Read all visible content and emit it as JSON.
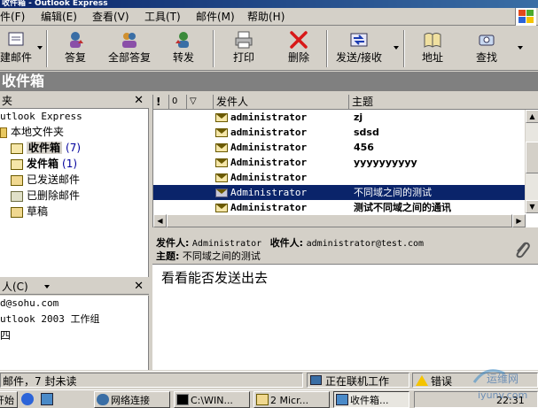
{
  "window": {
    "title": "收件箱 - Outlook Express"
  },
  "menu": [
    "件(F)",
    "编辑(E)",
    "查看(V)",
    "工具(T)",
    "邮件(M)",
    "帮助(H)"
  ],
  "toolbar": {
    "new_mail": "建邮件",
    "reply": "答复",
    "reply_all": "全部答复",
    "forward": "转发",
    "print": "打印",
    "delete": "删除",
    "send_receive": "发送/接收",
    "addresses": "地址",
    "find": "查找"
  },
  "folder_header": "收件箱",
  "folders_pane": {
    "title": "夹",
    "root": "utlook Express",
    "items": [
      {
        "label": "本地文件夹",
        "count": ""
      },
      {
        "label": "收件箱",
        "count": "(7)"
      },
      {
        "label": "发件箱",
        "count": "(1)"
      },
      {
        "label": "已发送邮件",
        "count": ""
      },
      {
        "label": "已删除邮件",
        "count": ""
      },
      {
        "label": "草稿",
        "count": ""
      }
    ]
  },
  "contacts_pane": {
    "title": "人(C)",
    "items": [
      "d@sohu.com",
      "utlook 2003 工作组",
      "四"
    ]
  },
  "message_list": {
    "columns": {
      "priority": "!",
      "attachment": "0",
      "flag": "▽",
      "from": "发件人",
      "subject": "主题"
    },
    "rows": [
      {
        "from": "administrator",
        "subject": "zj",
        "unread": true,
        "selected": false
      },
      {
        "from": "administrator",
        "subject": "sdsd",
        "unread": true,
        "selected": false
      },
      {
        "from": "Administrator",
        "subject": "456",
        "unread": true,
        "selected": false
      },
      {
        "from": "Administrator",
        "subject": "yyyyyyyyyy",
        "unread": true,
        "selected": false
      },
      {
        "from": "Administrator",
        "subject": "",
        "unread": true,
        "selected": false
      },
      {
        "from": "Administrator",
        "subject": "不同域之间的测试",
        "unread": false,
        "selected": true
      },
      {
        "from": "Administrator",
        "subject": "测试不同域之间的通讯",
        "unread": true,
        "selected": false
      }
    ]
  },
  "preview": {
    "from_label": "发件人:",
    "from_value": "Administrator",
    "to_label": "收件人:",
    "to_value": "administrator@test.com",
    "subject_label": "主题:",
    "subject_value": "不同域之间的测试",
    "body": "看看能否发送出去"
  },
  "status": {
    "summary": "邮件，7 封未读",
    "online": "正在联机工作",
    "error": "错误"
  },
  "taskbar": {
    "start": "开始",
    "tasks": [
      "网络连接",
      "C:\\WIN...",
      "2 Micr...",
      "收件箱..."
    ],
    "clock": "22:31"
  },
  "colors": {
    "selection": "#0a246a",
    "face": "#d4d0c8",
    "folder_header": "#808080"
  },
  "watermark": {
    "text": "运维网",
    "sub": "iyunv.com"
  }
}
